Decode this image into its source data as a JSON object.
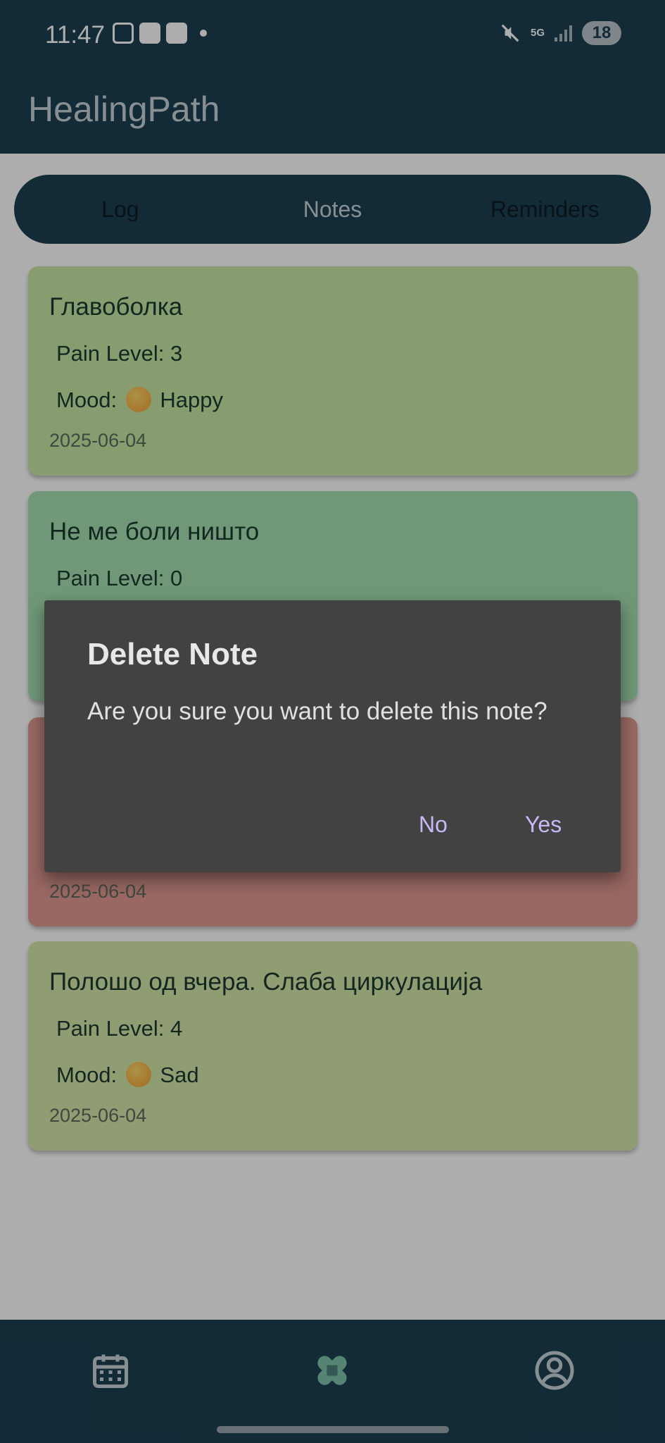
{
  "status_bar": {
    "time": "11:47",
    "network": "5G",
    "battery": "18"
  },
  "app": {
    "title": "HealingPath"
  },
  "tabs": [
    {
      "label": "Log"
    },
    {
      "label": "Notes"
    },
    {
      "label": "Reminders"
    }
  ],
  "notes": [
    {
      "title": "Главоболка",
      "pain_level": "Pain Level: 3",
      "mood_label": "Mood:",
      "mood_value": "Happy",
      "date": "2025-06-04",
      "color": "#c7e7a5"
    },
    {
      "title": "Не ме боли ништо",
      "pain_level": "Pain Level: 0",
      "date": "",
      "color": "#a6e1b2"
    },
    {
      "title": "",
      "date": "2025-06-04",
      "color": "#e29a92"
    },
    {
      "title": "Полошо од вчера. Слаба циркулација",
      "pain_level": "Pain Level: 4",
      "mood_label": "Mood:",
      "mood_value": "Sad",
      "date": "2025-06-04",
      "color": "#d4e6a8"
    }
  ],
  "dialog": {
    "title": "Delete Note",
    "message": "Are you sure you want to delete this note?",
    "no_label": "No",
    "yes_label": "Yes"
  },
  "bottom_nav": {
    "items": [
      {
        "icon": "calendar-icon"
      },
      {
        "icon": "bandage-icon"
      },
      {
        "icon": "profile-icon"
      }
    ]
  },
  "colors": {
    "primary": "#1c4052",
    "dialog_bg": "#424242",
    "dialog_accent": "#c9b8f5"
  }
}
